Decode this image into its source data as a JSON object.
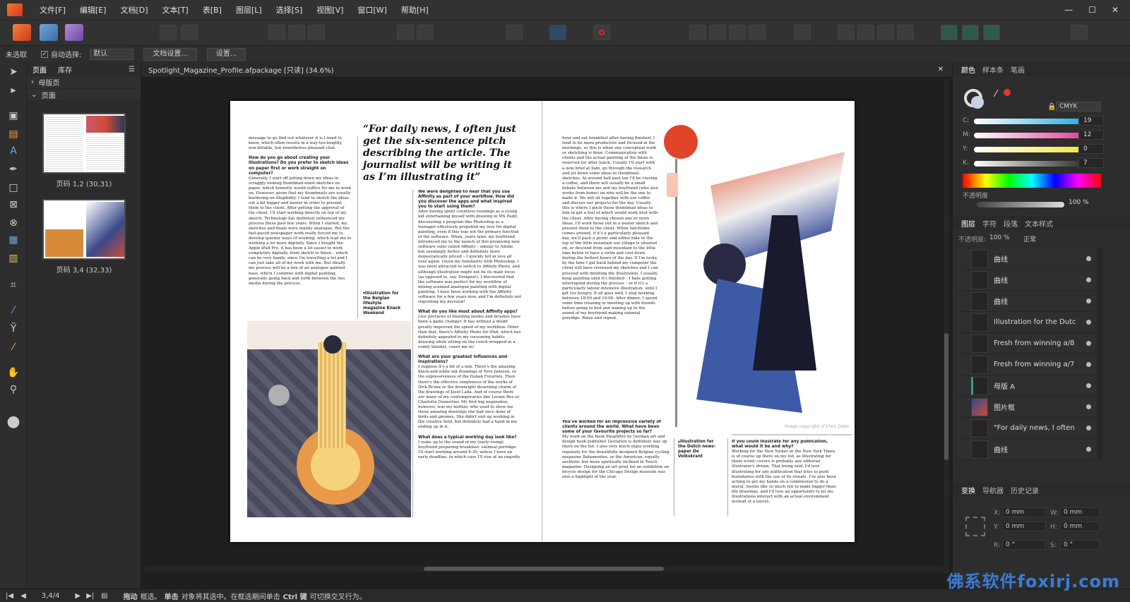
{
  "menu": [
    "文件[F]",
    "编辑[E]",
    "文档[D]",
    "文本[T]",
    "表[B]",
    "图层[L]",
    "选择[S]",
    "视图[V]",
    "窗口[W]",
    "帮助[H]"
  ],
  "window_controls": [
    "—",
    "☐",
    "✕"
  ],
  "context": {
    "selection": "未选取",
    "auto_select_label": "自动选择:",
    "auto_select_value": "默认",
    "doc_settings": "文档设置...",
    "settings": "设置..."
  },
  "pages_panel": {
    "tabs": [
      "页面",
      "库存"
    ],
    "masters": "母版页",
    "pages": "页面",
    "thumbs": [
      "页码 1,2 (30,31)",
      "页码 3,4 (32,33)"
    ]
  },
  "document": {
    "tab_title": "Spotlight_Magazine_Profile.afpackage [只读] (34.6%)",
    "pull_quote": "“For daily news, I often just get the six-sentence pitch describing the article. The journalist will be writing it as I’m illustrating it”",
    "caption_left": "▾Illustration for the Belgian lifestyle magazine Knack Weekend",
    "caption_right": "▴Illustration for the Dutch news-paper De Volkskrant",
    "image_credit": "Image copyright of Eleni Debo",
    "col1_a": "message to go find out whatever it is I need to know, which often results in a way-too-lengthy, non-billable, but nonetheless pleasant chat.",
    "col1_q1": "How do you go about creating your illustrations? Do you prefer to sketch ideas on paper first or work straight on computer?",
    "col1_b": "Generally I start off jotting down my ideas in scraggly looking thumbnail-sized sketches on paper, which honestly would suffice for me to work on. However, given that my thumbnails are usually bordering on illegibility, I tend to sketch the ideas out a bit bigger and neater in order to present them to the client. After getting the approval of the client, I'll start working directly on top of my sketch. Technology has definitely influenced my process these past few years. When I started, my sketches and finals were mainly analogue. But the fast-paced newspaper work really forced me to develop quicker ways of working, which lead me to working a lot more digitally. Since I bought the Apple iPad Pro, it has been a lot easier to work completely digitally, from sketch to finish – which can be very handy, since I'm travelling a lot and I can just take all of my work with me. But ideally my process will be a mix of an analogue painted base, which I combine with digital painting, generally going back and forth between the two media during the process.",
    "col2_q1": "We were delighted to hear that you use Affinity as part of your workflow. How did you discover the apps and what inspired you to start using them?",
    "col2_a": "After having spent countless evenings as a young kid entertaining myself with drawing in MS Paint, discovering a program like Photoshop as a teenager effectively propelled my love for digital painting, even if this was not the primary function of the software. When, years later, my boyfriend introduced me to the launch of this promising new software suite called Affinity – similar to Adobe, but seemingly better and definitely more democratically priced – I quickly fell in love all over again. Given my familiarity with Photoshop, I was most attracted to switch to Affinity Photo, and although illustration might not be its main focus (as opposed to, say, Designer), I discovered that the software was perfect for my workflow of mixing scanned analogue painting with digital painting. I have been working with the Affinity software for a few years now, and I'm definitely not regretting my decision!",
    "col2_q2": "What do you like most about Affinity apps?",
    "col2_b": "Live previews of blending modes and brushes have been a game changer. It has without a doubt greatly improved the speed of my workflow. Other than that, there's Affinity Photo for iPad, which has definitely appealed to my cocooning habits: drawing while sitting on the couch wrapped in a comfy blanket, count me in!",
    "col2_q3": "What are your greatest influences and inspirations?",
    "col2_c": "I suppose it's a bit of a mix. There's the amazing black-and-white ink drawings of Tove Jansson, or the expressiveness of the Italian Futurists. Then there's the effective simpleness of the works of Dick Bruna or the downright disarming charm of the drawings of Josef Lada. And of course there are many of my contemporaries like Leonie Bos or Charlotte Dumortier. My first big inspiration, however, was my mother, who used to show me these amazing drawings she had once done of birds and gnomes. She didn't end up working in the creative field, but definitely had a hand in me ending up in it.",
    "col2_q4": "What does a typical working day look like?",
    "col2_d": "I wake up to the sound of my (early-rising) boyfriend preparing breakfast: oatmeal porridge. I'll start working around 8:30, unless I have an early deadline, in which case I'll rise at an ungodly",
    "col3_a": "hour and eat breakfast after having finished. I tend to be more productive and focused in the mornings, so this is when any conceptual work or sketching is done. Communication with clients and the actual painting of the finals is reserved for after lunch. Usually I'll start with a new brief at 9am, go through the research and jot down some ideas in thumbnail-sketches. At around half past ten I'll be craving a coffee, and there will usually be a small debate between me and my boyfriend (who also works from home) on who will be the one to make it. We will sit together with our coffee and discuss our projects for the day. Usually this is where I pitch those thumbnail ideas to him to get a feel of which would work best with the client. After having chosen one or more ideas, I'll work those out in a neater sketch and present them to the client. When lunchtime comes around, if it's a particularly pleasant day, we'll pack a picnic and either bike to the top of the little mountain our village is situated on, or descend from said mountain to the little lake below to have a swim and cool down during the hottest hours of the day. If I'm lucky, by the time I get back behind my computer the client will have reviewed my sketches and I can proceed with finishing the illustration. I usually keep painting until it's finished – I hate getting interrupted during the process – or if it's a particularly labour-intensive illustration, until I get too hungry. If all goes well, I stop working between 18:00 and 19:00. After dinner, I spend some time relaxing or meeting up with friends before going to bed and waking up to the sound of my boyfriend making oatmeal porridge. Rinse and repeat.",
    "col3_q": "You've worked for an impressive variety of clients around the world. What have been some of your favourite projects so far?",
    "col3_b": "My work on the book Shoplifter by German art and design book publisher Gestalten is definitely way up there on the list. I also very much enjoy working regularly for the beautifully designed Belgian cycling magazine Bahamontes, or the American, equally aesthetic but more spiritually inclined In Touch magazine. Designing an art print for an exhibition on bicycle design for the Chicago Design museum was also a highlight of the year.",
    "col4_q": "If you could illustrate for any publication, what would it be and why?",
    "col4_a": "Working for the New Yorker or the New York Times is of course up there on my list, as illustrating for those iconic covers is probably any editorial illustrator's dream. That being said, I'd love illustrating for any publication that tries to push boundaries with the use of its visuals. I've also been aching to get my hands on a commission to do a mural. Seems like so much fun to make bigger-than-life drawings, and I'd love an opportunity to let my illustrations interact with an actual environment instead of a layout."
  },
  "color_panel": {
    "tabs": [
      "颜色",
      "样本条",
      "笔画"
    ],
    "model": "CMYK",
    "channels": [
      {
        "label": "C:",
        "value": "19"
      },
      {
        "label": "M:",
        "value": "12"
      },
      {
        "label": "Y:",
        "value": "0"
      },
      {
        "label": "K:",
        "value": "7"
      }
    ],
    "opacity_label": "不透明度",
    "opacity_value": "100 %"
  },
  "layers_panel": {
    "tabs": [
      "图层",
      "字符",
      "段落",
      "文本样式"
    ],
    "opacity_label": "不透明度:",
    "opacity_value": "100 %",
    "blend": "正常",
    "layers": [
      "曲线",
      "曲线",
      "曲线",
      "Illustration for the Dutc",
      "Fresh from winning a/8",
      "Fresh from winning a/7",
      "母版 A",
      "图片框",
      "\"For daily news, I often",
      "曲线"
    ]
  },
  "transform_panel": {
    "tabs": [
      "变换",
      "导航器",
      "历史记录"
    ],
    "fields": [
      {
        "label": "X:",
        "value": "0 mm"
      },
      {
        "label": "W:",
        "value": "0 mm"
      },
      {
        "label": "Y:",
        "value": "0 mm"
      },
      {
        "label": "H:",
        "value": "0 mm"
      },
      {
        "label": "R:",
        "value": "0 °"
      },
      {
        "label": "S:",
        "value": "0 °"
      }
    ]
  },
  "status": {
    "page": "3,4/4",
    "hint_bold1": "拖动",
    "hint1": "框选。",
    "hint_bold2": "单击",
    "hint2": "对象将其选中。在框选期间单击",
    "hint_bold3": "Ctrl 键",
    "hint3": "可切换交叉行为。"
  },
  "watermark": "佛系软件foxirj.com",
  "colors": {
    "accent": "#f07a2e",
    "watermark": "#3b7bd8"
  }
}
